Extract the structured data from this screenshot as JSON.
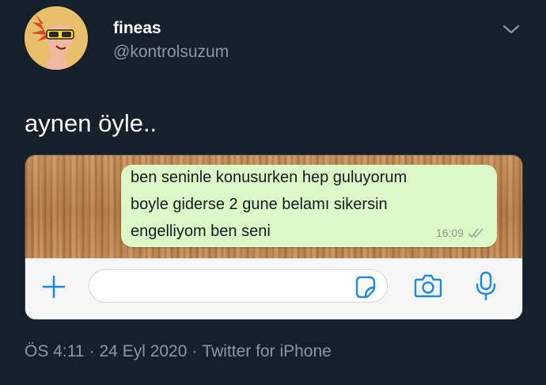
{
  "author": {
    "display_name": "fineas",
    "handle": "@kontrolsuzum"
  },
  "tweet": {
    "text": "aynen öyle.."
  },
  "screenshot": {
    "message_lines": [
      "ben seninle konusurken hep guluyorum",
      "boyle giderse 2 gune belamı sikersin",
      "engelliyom ben seni"
    ],
    "time": "16:09",
    "input_value": "",
    "icons": [
      "plus-icon",
      "sticker-icon",
      "camera-icon",
      "microphone-icon",
      "double-check-icon"
    ],
    "colors": {
      "bubble": "#dcf8c6",
      "accent": "#1e88e5"
    }
  },
  "meta": {
    "time": "ÖS 4:11",
    "date": "24 Eyl 2020",
    "separator": "·",
    "source": "Twitter for iPhone"
  },
  "colors": {
    "background": "#15202b",
    "secondary_text": "#8899a6"
  }
}
